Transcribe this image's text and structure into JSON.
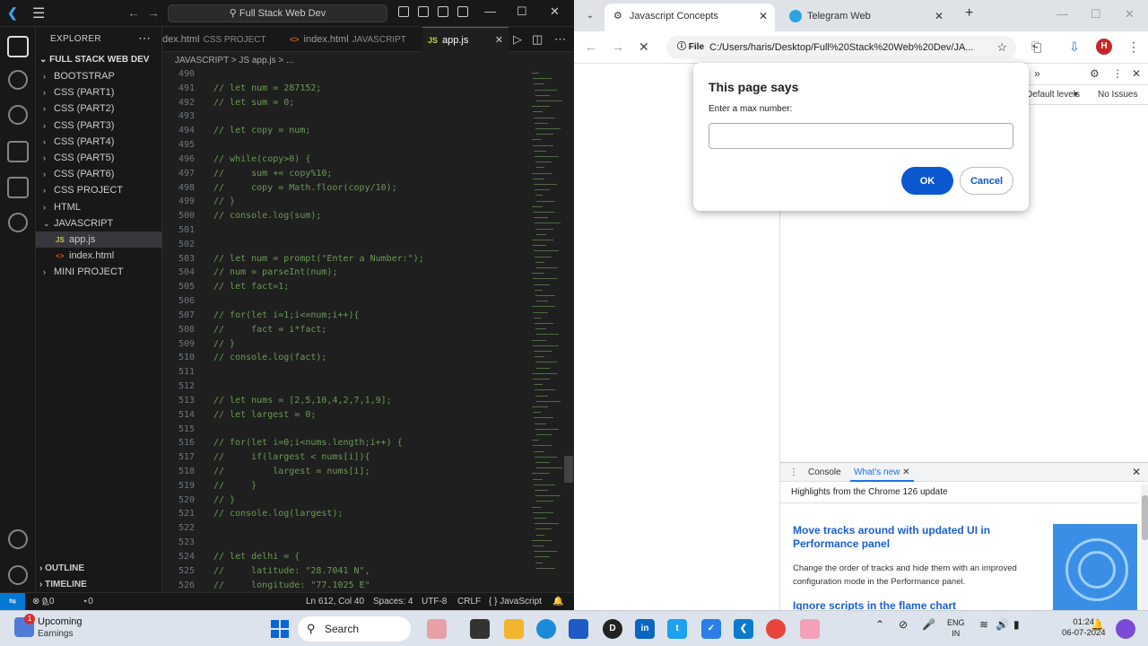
{
  "vscode": {
    "search_label": "Full Stack Web Dev",
    "explorer_label": "EXPLORER",
    "root_folder": "FULL STACK WEB DEV",
    "tree": [
      {
        "label": "BOOTSTRAP",
        "type": "folder",
        "expanded": false
      },
      {
        "label": "CSS (PART1)",
        "type": "folder",
        "expanded": false
      },
      {
        "label": "CSS (PART2)",
        "type": "folder",
        "expanded": false
      },
      {
        "label": "CSS (PART3)",
        "type": "folder",
        "expanded": false
      },
      {
        "label": "CSS (PART4)",
        "type": "folder",
        "expanded": false
      },
      {
        "label": "CSS (PART5)",
        "type": "folder",
        "expanded": false
      },
      {
        "label": "CSS (PART6)",
        "type": "folder",
        "expanded": false
      },
      {
        "label": "CSS PROJECT",
        "type": "folder",
        "expanded": false
      },
      {
        "label": "HTML",
        "type": "folder",
        "expanded": false
      },
      {
        "label": "JAVASCRIPT",
        "type": "folder",
        "expanded": true
      },
      {
        "label": "app.js",
        "type": "js",
        "selected": true
      },
      {
        "label": "index.html",
        "type": "html"
      },
      {
        "label": "MINI PROJECT",
        "type": "folder",
        "expanded": false
      }
    ],
    "outline_label": "OUTLINE",
    "timeline_label": "TIMELINE",
    "tabs": [
      {
        "label": "dex.html",
        "sub": "CSS PROJECT",
        "icon": "<>"
      },
      {
        "label": "index.html",
        "sub": "JAVASCRIPT",
        "icon": "<>"
      },
      {
        "label": "app.js",
        "sub": "",
        "icon": "JS",
        "active": true
      }
    ],
    "breadcrumb": "JAVASCRIPT  >  JS app.js  >  ...",
    "code_lines": [
      {
        "n": "490",
        "t": ""
      },
      {
        "n": "491",
        "t": "// let num = 287152;"
      },
      {
        "n": "492",
        "t": "// let sum = 0;"
      },
      {
        "n": "493",
        "t": ""
      },
      {
        "n": "494",
        "t": "// let copy = num;"
      },
      {
        "n": "495",
        "t": ""
      },
      {
        "n": "496",
        "t": "// while(copy>0) {"
      },
      {
        "n": "497",
        "t": "//     sum += copy%10;"
      },
      {
        "n": "498",
        "t": "//     copy = Math.floor(copy/10);"
      },
      {
        "n": "499",
        "t": "// }"
      },
      {
        "n": "500",
        "t": "// console.log(sum);"
      },
      {
        "n": "501",
        "t": ""
      },
      {
        "n": "502",
        "t": ""
      },
      {
        "n": "503",
        "t": "// let num = prompt(\"Enter a Number:\");"
      },
      {
        "n": "504",
        "t": "// num = parseInt(num);"
      },
      {
        "n": "505",
        "t": "// let fact=1;"
      },
      {
        "n": "506",
        "t": ""
      },
      {
        "n": "507",
        "t": "// for(let i=1;i<=num;i++){"
      },
      {
        "n": "508",
        "t": "//     fact = i*fact;"
      },
      {
        "n": "509",
        "t": "// }"
      },
      {
        "n": "510",
        "t": "// console.log(fact);"
      },
      {
        "n": "511",
        "t": ""
      },
      {
        "n": "512",
        "t": ""
      },
      {
        "n": "513",
        "t": "// let nums = [2,5,10,4,2,7,1,9];"
      },
      {
        "n": "514",
        "t": "// let largest = 0;"
      },
      {
        "n": "515",
        "t": ""
      },
      {
        "n": "516",
        "t": "// for(let i=0;i<nums.length;i++) {"
      },
      {
        "n": "517",
        "t": "//     if(largest < nums[i]){"
      },
      {
        "n": "518",
        "t": "//         largest = nums[i];"
      },
      {
        "n": "519",
        "t": "//     }"
      },
      {
        "n": "520",
        "t": "// }"
      },
      {
        "n": "521",
        "t": "// console.log(largest);"
      },
      {
        "n": "522",
        "t": ""
      },
      {
        "n": "523",
        "t": ""
      },
      {
        "n": "524",
        "t": "// let delhi = {"
      },
      {
        "n": "525",
        "t": "//     latitude: \"28.7041 N\","
      },
      {
        "n": "526",
        "t": "//     longitude: \"77.1025 E\""
      }
    ],
    "status": {
      "errors": "0",
      "warnings": "0",
      "ports": "0",
      "position": "Ln 612, Col 40",
      "spaces": "Spaces: 4",
      "encoding": "UTF-8",
      "eol": "CRLF",
      "language": "{ } JavaScript"
    }
  },
  "chrome": {
    "tabs": [
      {
        "label": "Javascript Concepts",
        "active": true
      },
      {
        "label": "Telegram Web",
        "active": false
      }
    ],
    "address_chip": "File",
    "address_url": "C:/Users/haris/Desktop/Full%20Stack%20Web%20Dev/JA...",
    "profile_initial": "H",
    "devtools": {
      "levels_label": "Default levels",
      "issues_label": "No Issues",
      "drawer_tabs": [
        "Console",
        "What's new"
      ],
      "highlights": "Highlights from the Chrome 126 update",
      "article1_title": "Move tracks around with updated UI in Performance panel",
      "article1_body": "Change the order of tracks and hide them with an improved configuration mode in the Performance panel.",
      "article2_title": "Ignore scripts in the flame chart"
    },
    "dialog": {
      "title": "This page says",
      "message": "Enter a max number:",
      "input_value": "",
      "ok_label": "OK",
      "cancel_label": "Cancel"
    }
  },
  "taskbar": {
    "weather_badge": "1",
    "weather_line1": "Upcoming",
    "weather_line2": "Earnings",
    "search_label": "Search",
    "lang_line1": "ENG",
    "lang_line2": "IN",
    "time": "01:24",
    "date": "06-07-2024"
  },
  "colors": {
    "vscode_bg": "#1f1f1f",
    "comment": "#6a9955",
    "accent_blue": "#0078d4",
    "chrome_button": "#0b57d0"
  }
}
